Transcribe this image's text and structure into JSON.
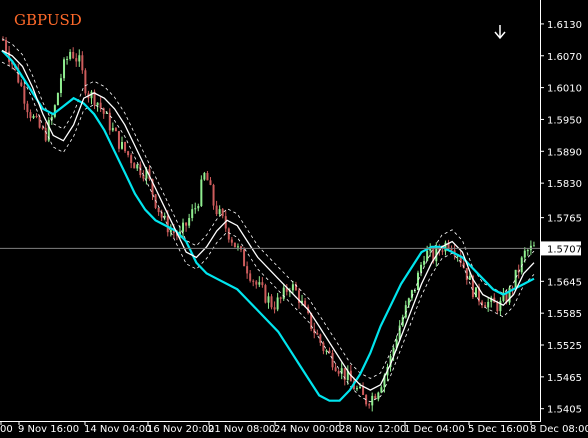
{
  "chart_data": {
    "type": "candlestick",
    "title": "GBPUSD",
    "current_price": "1.5707",
    "colors": {
      "background": "#000000",
      "bull": "#90ee90",
      "bear": "#cd5c5c",
      "ma_fast": "#ffffff",
      "ma_slow": "#00e5ee",
      "envelope": "#ffffff",
      "grid_line": "#808080",
      "title": "#ff6a2a"
    },
    "y_ticks": [
      "1.6130",
      "1.6070",
      "1.6010",
      "1.5950",
      "1.5890",
      "1.5830",
      "1.5765",
      "1.5707",
      "1.5645",
      "1.5585",
      "1.5525",
      "1.5465",
      "1.5405"
    ],
    "y_range": [
      1.5395,
      1.616
    ],
    "x_ticks": [
      "00",
      "9 Nov 16:00",
      "14 Nov 04:00",
      "16 Nov 20:00",
      "21 Nov 08:00",
      "24 Nov 00:00",
      "28 Nov 12:00",
      "1 Dec 04:00",
      "5 Dec 16:00",
      "8 Dec 08:00"
    ],
    "ohlc_close": [
      1.61,
      1.606,
      1.602,
      1.597,
      1.594,
      1.592,
      1.596,
      1.604,
      1.608,
      1.606,
      1.6,
      1.599,
      1.596,
      1.593,
      1.59,
      1.588,
      1.586,
      1.585,
      1.58,
      1.576,
      1.574,
      1.573,
      1.576,
      1.579,
      1.585,
      1.579,
      1.576,
      1.573,
      1.57,
      1.567,
      1.564,
      1.562,
      1.56,
      1.561,
      1.564,
      1.562,
      1.558,
      1.555,
      1.552,
      1.55,
      1.548,
      1.546,
      1.544,
      1.542,
      1.543,
      1.546,
      1.55,
      1.556,
      1.56,
      1.564,
      1.57,
      1.569,
      1.571,
      1.572,
      1.57,
      1.566,
      1.562,
      1.561,
      1.56,
      1.56,
      1.562,
      1.566,
      1.57,
      1.5707
    ],
    "ma_fast": [
      1.608,
      1.607,
      1.605,
      1.601,
      1.596,
      1.592,
      1.591,
      1.594,
      1.599,
      1.6,
      1.599,
      1.597,
      1.594,
      1.59,
      1.586,
      1.582,
      1.578,
      1.574,
      1.57,
      1.569,
      1.571,
      1.574,
      1.576,
      1.575,
      1.572,
      1.569,
      1.567,
      1.565,
      1.563,
      1.561,
      1.559,
      1.556,
      1.553,
      1.55,
      1.547,
      1.545,
      1.544,
      1.545,
      1.549,
      1.554,
      1.559,
      1.564,
      1.568,
      1.571,
      1.572,
      1.57,
      1.565,
      1.562,
      1.561,
      1.56,
      1.562,
      1.566,
      1.568
    ],
    "ma_slow": [
      1.608,
      1.606,
      1.603,
      1.6,
      1.597,
      1.596,
      1.5975,
      1.599,
      1.598,
      1.596,
      1.593,
      1.589,
      1.585,
      1.581,
      1.578,
      1.576,
      1.575,
      1.574,
      1.572,
      1.568,
      1.566,
      1.565,
      1.564,
      1.563,
      1.561,
      1.559,
      1.557,
      1.555,
      1.552,
      1.549,
      1.546,
      1.543,
      1.542,
      1.542,
      1.544,
      1.547,
      1.551,
      1.556,
      1.56,
      1.564,
      1.567,
      1.57,
      1.571,
      1.571,
      1.57,
      1.569,
      1.567,
      1.565,
      1.563,
      1.562,
      1.563,
      1.564,
      1.565
    ]
  },
  "header": {
    "symbol": "GBPUSD",
    "arrow": "down-arrow-icon"
  }
}
